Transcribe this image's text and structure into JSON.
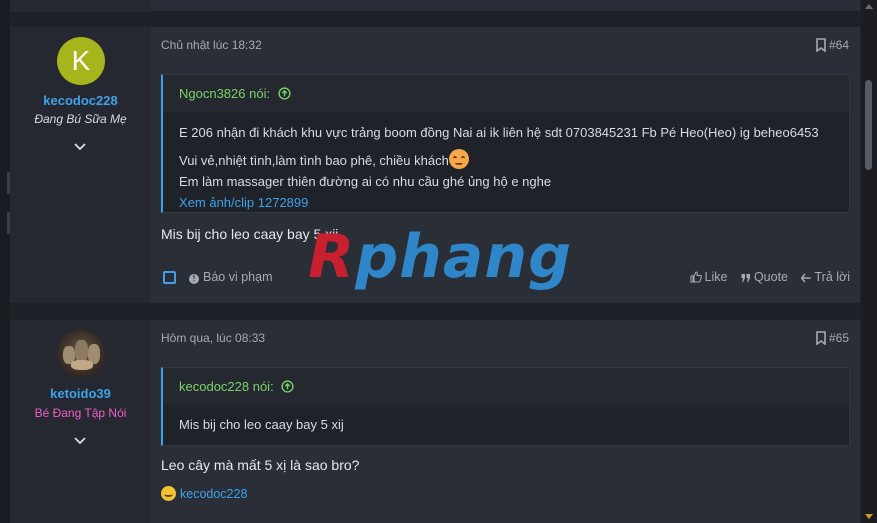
{
  "colors": {
    "accent": "#3fa1e8",
    "quote_author": "#7ad36a",
    "username": "#3fa1e8",
    "pink_title": "#f25ec4",
    "avatar_k_bg": "#a7b51c"
  },
  "watermark": {
    "first": "R",
    "rest": "phang"
  },
  "posts": [
    {
      "user": {
        "initial": "K",
        "name": "kecodoc228",
        "title": "Đang Bú Sữa Mẹ"
      },
      "date": "Chủ nhật lúc 18:32",
      "number": "#64",
      "quote": {
        "author": "Ngocn3826 nói:",
        "line1": "E 206 nhận đi khách khu vực trảng boom đồng Nai ai ik liên hệ sdt 0703845231 Fb Pé Heo(Heo) ig beheo6453",
        "line2": "Vui vẻ,nhiệt tình,làm tình bao phê, chiều khách",
        "line3": "Em làm massager thiên đường ai có nhu cầu ghé ủng hộ e nghe",
        "link": "Xem ảnh/clip 1272899"
      },
      "message": "Mis bij cho leo caay bay 5 xij",
      "actions": {
        "report": "Báo vi phạm",
        "like": "Like",
        "quote": "Quote",
        "reply": "Trả lời"
      }
    },
    {
      "user": {
        "name": "ketoido39",
        "title": "Bé Đang Tập Nói"
      },
      "date": "Hôm qua, lúc 08:33",
      "number": "#65",
      "quote": {
        "author": "kecodoc228 nói:",
        "line1": "Mis bij cho leo caay bay 5 xij"
      },
      "message": "Leo cây mà mất 5 xị là sao bro?",
      "reaction_user": "kecodoc228"
    }
  ]
}
